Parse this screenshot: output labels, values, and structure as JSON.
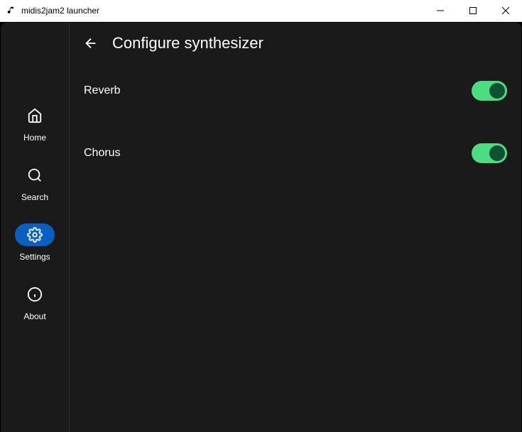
{
  "window": {
    "title": "midis2jam2 launcher"
  },
  "sidebar": {
    "items": [
      {
        "label": "Home"
      },
      {
        "label": "Search"
      },
      {
        "label": "Settings"
      },
      {
        "label": "About"
      }
    ]
  },
  "page": {
    "title": "Configure synthesizer"
  },
  "settings": {
    "reverb": {
      "label": "Reverb",
      "enabled": true
    },
    "chorus": {
      "label": "Chorus",
      "enabled": true
    }
  },
  "colors": {
    "accent": "#0860c4",
    "toggle_on": "#4ade80",
    "background": "#1a1a1a"
  }
}
